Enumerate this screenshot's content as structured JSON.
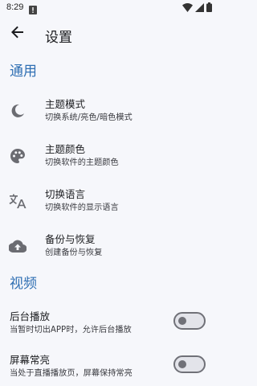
{
  "status_bar": {
    "time": "8:29",
    "icons": [
      "warning-icon",
      "wifi-icon",
      "cellular-icon",
      "battery-icon"
    ]
  },
  "app_bar": {
    "title": "设置",
    "back_icon": "arrow-back-icon"
  },
  "general": {
    "header": "通用",
    "items": [
      {
        "icon": "moon-icon",
        "title": "主题模式",
        "subtitle": "切换系统/亮色/暗色模式"
      },
      {
        "icon": "palette-icon",
        "title": "主题颜色",
        "subtitle": "切换软件的主题颜色"
      },
      {
        "icon": "translate-icon",
        "title": "切换语言",
        "subtitle": "切换软件的显示语言"
      },
      {
        "icon": "cloud-upload-icon",
        "title": "备份与恢复",
        "subtitle": "创建备份与恢复"
      }
    ]
  },
  "video": {
    "header": "视频",
    "items": [
      {
        "title": "后台播放",
        "subtitle": "当暂时切出APP时，允许后台播放",
        "enabled": false
      },
      {
        "title": "屏幕常亮",
        "subtitle": "当处于直播播放页，屏幕保持常亮",
        "enabled": false
      }
    ]
  },
  "colors": {
    "accent": "#2f6fb3",
    "background": "#f6f7fb",
    "icon": "#6b6c72"
  }
}
